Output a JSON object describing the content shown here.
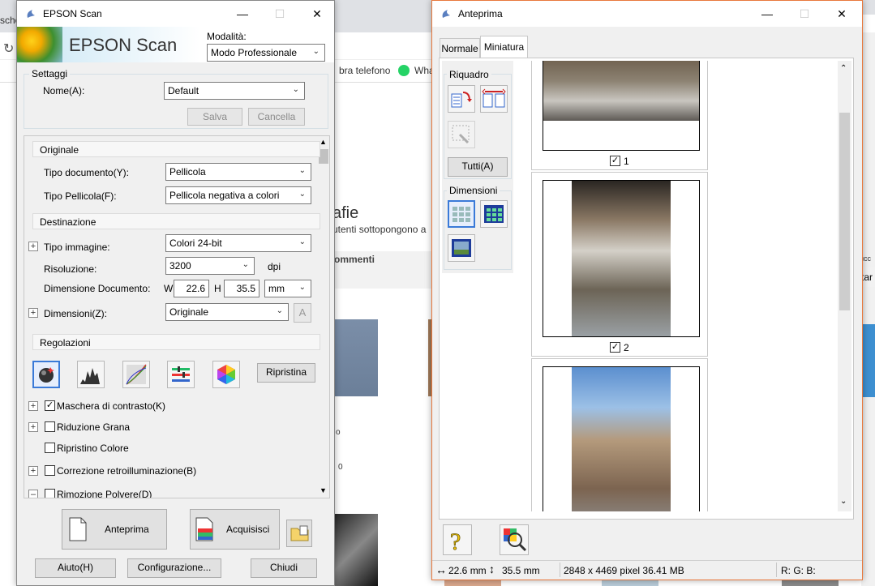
{
  "background": {
    "tab_fragment": "sche",
    "bookmarks": [
      "bra telefono",
      "Wha"
    ],
    "heading_fragment": "afie",
    "subtext_fragment": "utenti sottopongono a",
    "comments_fragment": "ommenti",
    "right_fragment_1": "ucc",
    "right_fragment_2": "tar",
    "frag_o": "o",
    "frag_0": "0"
  },
  "epson": {
    "title": "EPSON Scan",
    "banner_text": "EPSON Scan",
    "modalita_label": "Modalità:",
    "modalita_value": "Modo Professionale",
    "settaggi_label": "Settaggi",
    "nome_label": "Nome(A):",
    "nome_value": "Default",
    "salva_label": "Salva",
    "cancella_label": "Cancella",
    "originale_header": "Originale",
    "tipo_doc_label": "Tipo documento(Y):",
    "tipo_doc_value": "Pellicola",
    "tipo_pellicola_label": "Tipo Pellicola(F):",
    "tipo_pellicola_value": "Pellicola negativa a colori",
    "destinazione_header": "Destinazione",
    "tipo_immagine_label": "Tipo immagine:",
    "tipo_immagine_value": "Colori 24-bit",
    "risoluzione_label": "Risoluzione:",
    "risoluzione_value": "3200",
    "dpi_label": "dpi",
    "dim_doc_label": "Dimensione Documento:",
    "w_label": "W",
    "w_value": "22.6",
    "h_label": "H",
    "h_value": "35.5",
    "unit_value": "mm",
    "dimensioni_label": "Dimensioni(Z):",
    "dimensioni_value": "Originale",
    "regolazioni_header": "Regolazioni",
    "ripristina_label": "Ripristina",
    "options": [
      {
        "label": "Maschera di contrasto(K)",
        "checked": true,
        "expand": true
      },
      {
        "label": "Riduzione Grana",
        "checked": false,
        "expand": true
      },
      {
        "label": "Ripristino Colore",
        "checked": false,
        "expand": false
      },
      {
        "label": "Correzione retroilluminazione(B)",
        "checked": false,
        "expand": true
      },
      {
        "label": "Rimozione Polvere(D)",
        "checked": false,
        "expand": true
      }
    ],
    "anteprima_label": "Anteprima",
    "acquisisci_label": "Acquisisci",
    "aiuto_label": "Aiuto(H)",
    "configurazione_label": "Configurazione...",
    "chiudi_label": "Chiudi"
  },
  "preview": {
    "title": "Anteprima",
    "tabs": [
      "Normale",
      "Miniatura"
    ],
    "active_tab": "Miniatura",
    "riquadro_label": "Riquadro",
    "tutti_label": "Tutti(A)",
    "dimensioni_label": "Dimensioni",
    "frames": [
      {
        "number": "1",
        "checked": true
      },
      {
        "number": "2",
        "checked": true
      }
    ],
    "status_width": "22.6 mm",
    "status_height": "35.5 mm",
    "status_pixels": "2848 x 4469 pixel 36.41 MB",
    "status_rgb": "R: G: B:"
  },
  "colors": {
    "accent_border": "#e8783c",
    "selection_blue": "#3a7ad8"
  }
}
